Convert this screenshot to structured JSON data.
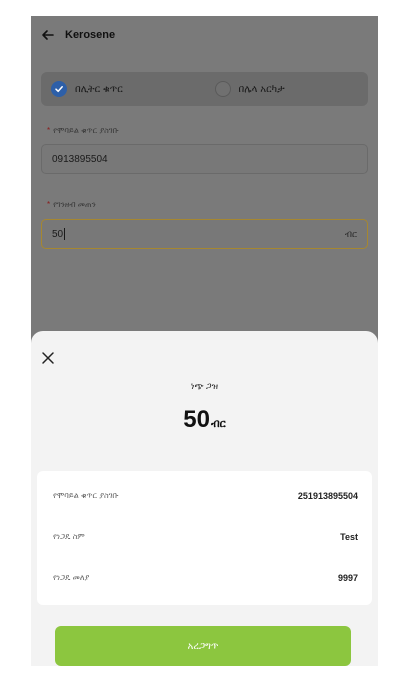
{
  "header": {
    "title": "Kerosene"
  },
  "mode_toggle": {
    "options": [
      {
        "label": "በሊትር ቁጥር",
        "selected": true
      },
      {
        "label": "በሌላ አርካታ",
        "selected": false
      }
    ]
  },
  "form": {
    "phone": {
      "label": "የሞባይል ቁጥር ያስገቡ",
      "value": "0913895504"
    },
    "amount": {
      "label": "የገንዘብ መጠን",
      "value": "50",
      "unit": "ብር"
    }
  },
  "sheet": {
    "label": "ነጭ ጋዝ",
    "amount_value": "50",
    "amount_unit": "ብር",
    "details": [
      {
        "label": "የሞባይል ቁጥር ያስገቡ",
        "value": "251913895504"
      },
      {
        "label": "የነጋዴ ስም",
        "value": "Test"
      },
      {
        "label": "የነጋዴ መለያ",
        "value": "9997"
      }
    ],
    "confirm_label": "አረጋግጥ"
  },
  "colors": {
    "accent_green": "#8cc63f",
    "radio_blue": "#2d5fa8",
    "focus_border": "#a6872f"
  }
}
